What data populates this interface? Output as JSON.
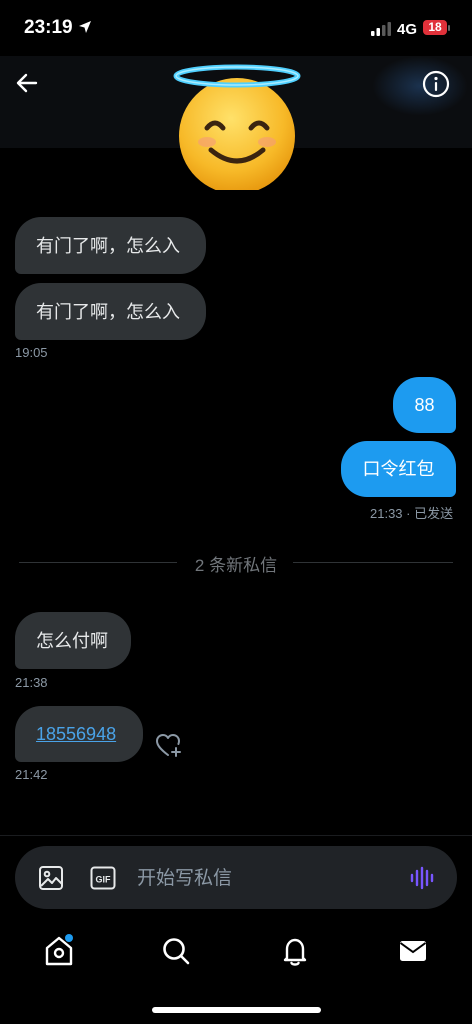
{
  "status_bar": {
    "time": "23:19",
    "network": "4G",
    "battery": "18"
  },
  "header": {
    "back_icon": "arrow-left-icon",
    "info_icon": "info-icon",
    "avatar_emoji": "😇"
  },
  "messages": {
    "m1": "有门了啊，怎么入",
    "m2": "有门了啊，怎么入",
    "t1": "19:05",
    "m3": "88",
    "m4": "口令红包",
    "t2": "21:33 · 已发送",
    "divider": "2 条新私信",
    "m5": "怎么付啊",
    "t3": "21:38",
    "m6": "18556948",
    "t4": "21:42"
  },
  "composer": {
    "placeholder": "开始写私信",
    "gif_label": "GIF"
  },
  "nav": {
    "items": [
      "home-icon",
      "search-icon",
      "bell-icon",
      "mail-icon"
    ]
  },
  "colors": {
    "accent": "#1d9bf0",
    "incoming_bubble": "#2f3336",
    "voice": "#7856ff",
    "notification_dot": "#1d9bf0",
    "battery_low": "#e0313a"
  }
}
